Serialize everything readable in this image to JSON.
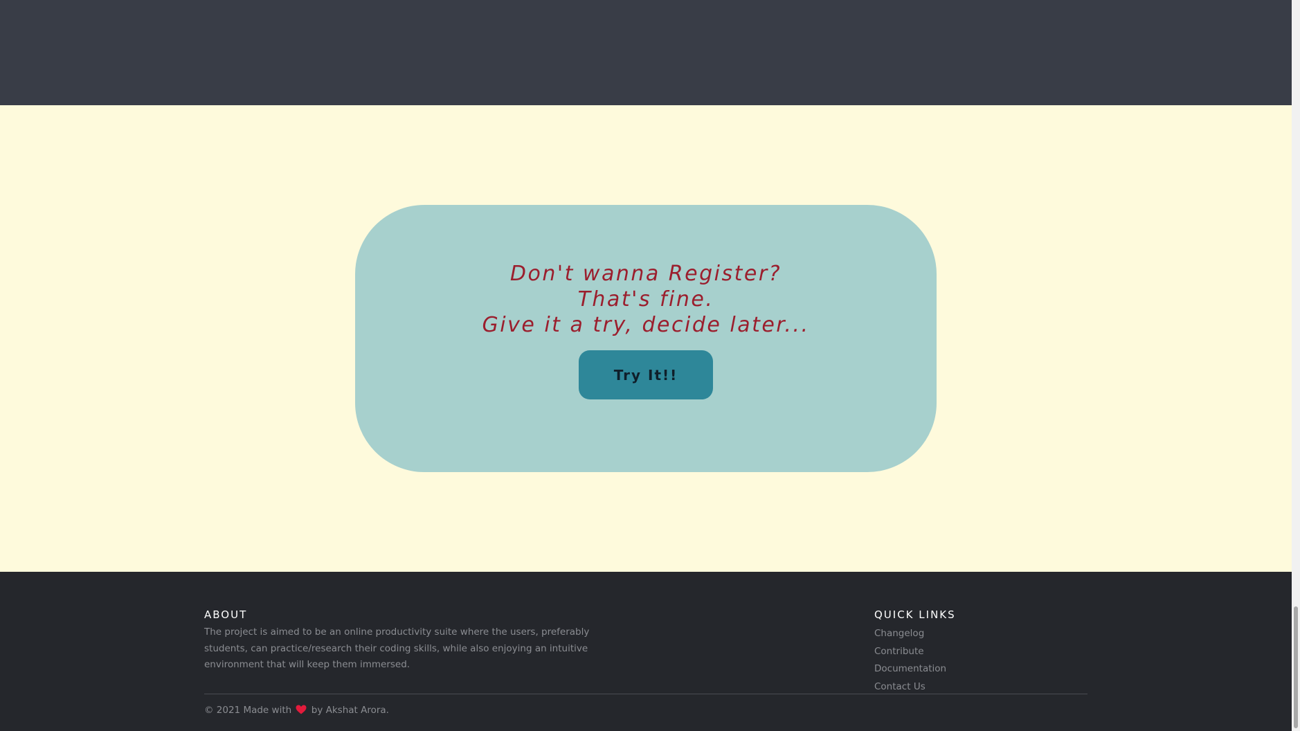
{
  "cta": {
    "heading_line1": "Don't wanna Register?",
    "heading_line2": "That's fine.",
    "heading_line3": "Give it a try, decide later...",
    "button_label": "Try It!!"
  },
  "footer": {
    "about": {
      "title": "ABOUT",
      "text": "The project is aimed to be an online productivity suite where the users, preferably students, can practice/research their coding skills, while also enjoying an intuitive environment that will keep them immersed."
    },
    "quick_links": {
      "title": "QUICK LINKS",
      "items": [
        "Changelog",
        "Contribute",
        "Documentation",
        "Contact Us"
      ]
    },
    "copyright_prefix": "© 2021 Made with",
    "copyright_suffix": "by Akshat Arora."
  },
  "colors": {
    "top_band": "#393d47",
    "section_bg": "#fefadc",
    "card_bg": "#a7d0cd",
    "heading": "#9b1e2d",
    "button_bg": "#2e8799",
    "footer_bg": "#25272c",
    "heart": "#e31b3c"
  },
  "icons": {
    "heart": "heart-icon"
  }
}
